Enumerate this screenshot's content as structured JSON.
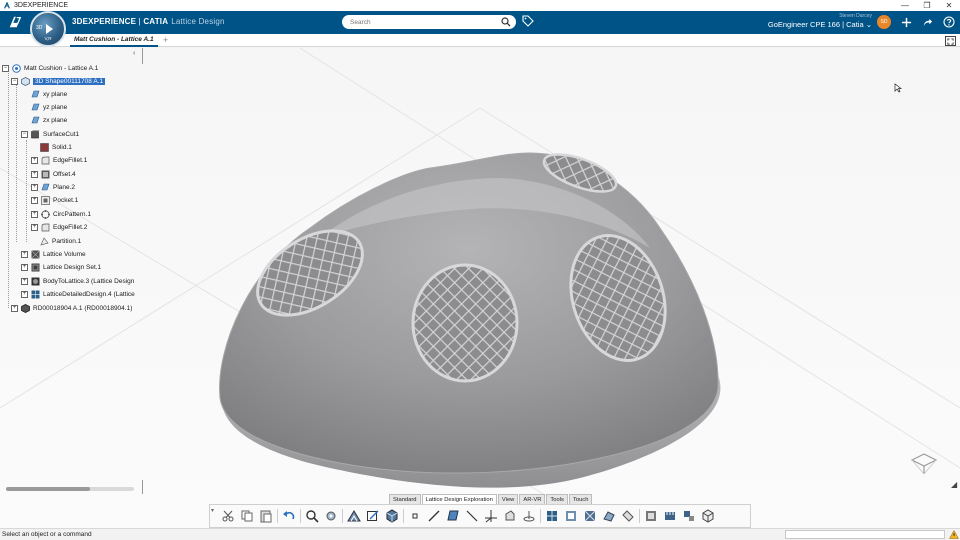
{
  "os_bar": {
    "title": "3DEXPERIENCE",
    "controls": [
      "—",
      "❐",
      "✕"
    ]
  },
  "header": {
    "brand_bold": "3DEXPERIENCE",
    "brand_sep": " | ",
    "brand_product": "CATIA",
    "app_name": "Lattice Design",
    "compass_3d": "3D",
    "compass_vr": "V,R",
    "search_placeholder": "Search",
    "user_name": "Steven Darcey",
    "user_context": "GoEngineer CPE 166 | Catia ⌄",
    "avatar_initials": "SD"
  },
  "tabs": {
    "active_label": "Matt Cushion - Lattice A.1",
    "add_label": "+"
  },
  "tree": {
    "root": "Matt Cushion - Lattice A.1",
    "nodes": [
      {
        "label": "3D Shape00111708 A.1",
        "selected": true
      },
      {
        "label": "xy plane"
      },
      {
        "label": "yz plane"
      },
      {
        "label": "zx plane"
      },
      {
        "label": "SurfaceCut1"
      },
      {
        "label": "Solid.1"
      },
      {
        "label": "EdgeFillet.1"
      },
      {
        "label": "Offset.4"
      },
      {
        "label": "Plane.2"
      },
      {
        "label": "Pocket.1"
      },
      {
        "label": "CircPattern.1"
      },
      {
        "label": "EdgeFillet.2"
      },
      {
        "label": "Partition.1"
      },
      {
        "label": "Lattice Volume"
      },
      {
        "label": "Lattice Design Set.1"
      },
      {
        "label": "BodyToLattice.3 (Lattice Design"
      },
      {
        "label": "LatticeDetailedDesign.4 (Lattice"
      },
      {
        "label": "RD00018904 A.1 (RD00018904.1)"
      }
    ]
  },
  "action_bar": {
    "sections": [
      "Standard",
      "Lattice Design Exploration",
      "View",
      "AR-VR",
      "Tools",
      "Touch"
    ],
    "active_section": "Lattice Design Exploration"
  },
  "status": {
    "message": "Select an object or a command"
  },
  "colors": {
    "header_bg": "#005386",
    "selection": "#2d6fc0",
    "avatar": "#e8872a"
  }
}
